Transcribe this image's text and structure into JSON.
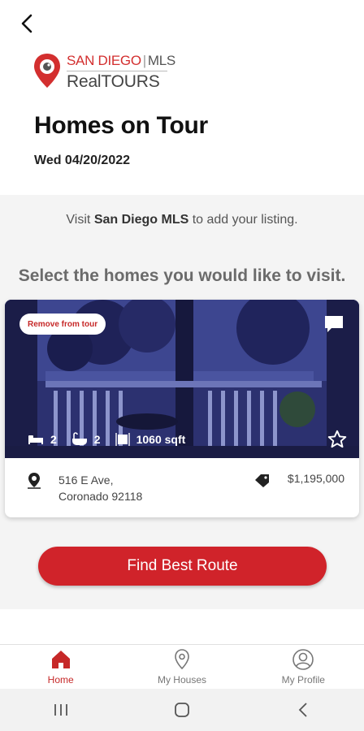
{
  "header": {
    "logo": {
      "brand_top": "SAN DIEGO",
      "brand_top_suffix": "MLS",
      "brand_bottom": "RealTOURS",
      "color": "#d32f2f"
    },
    "title": "Homes on Tour",
    "date": "Wed 04/20/2022"
  },
  "main": {
    "visit_prefix": "Visit ",
    "visit_link": "San Diego MLS",
    "visit_suffix": " to add your listing.",
    "select_prompt": "Select the homes you would like to visit.",
    "listing": {
      "remove_label": "Remove from tour",
      "beds": "2",
      "baths": "2",
      "sqft": "1060 sqft",
      "address_line1": "516 E Ave,",
      "address_line2": "Coronado 92118",
      "price": "$1,195,000"
    },
    "route_button": "Find Best Route"
  },
  "tabs": [
    {
      "label": "Home",
      "icon": "home-icon",
      "active": true
    },
    {
      "label": "My Houses",
      "icon": "location-pin-icon",
      "active": false
    },
    {
      "label": "My Profile",
      "icon": "profile-icon",
      "active": false
    }
  ],
  "colors": {
    "accent": "#d0232a",
    "photo_tint": "#2a2e6e"
  }
}
